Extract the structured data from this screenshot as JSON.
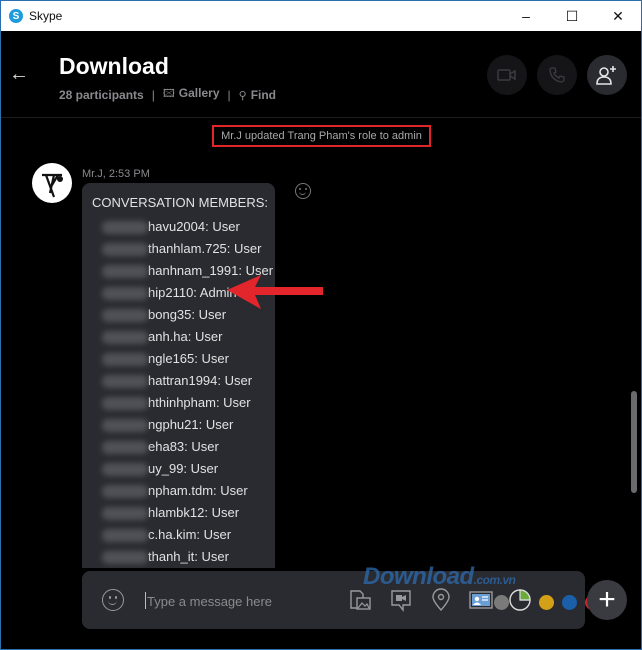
{
  "window": {
    "app_title": "Skype",
    "controls": {
      "minimize": "–",
      "maximize": "☐",
      "close": "✕"
    }
  },
  "header": {
    "back_icon": "←",
    "conversation_title": "Download",
    "participants": "28 participants",
    "separator": "|",
    "gallery_label": "Gallery",
    "find_label": "Find",
    "buttons": [
      "video-call",
      "audio-call",
      "add-participant"
    ]
  },
  "system_message": "Mr.J updated Trang Pham's role to admin",
  "message": {
    "sender_time": "Mr.J, 2:53 PM",
    "heading": "CONVERSATION MEMBERS:",
    "members": [
      "havu2004: User",
      "thanhlam.725: User",
      "hanhnam_1991: User",
      "hip2110: Admin",
      "bong35: User",
      "anh.ha: User",
      "ngle165: User",
      "hattran1994: User",
      "hthinhpham: User",
      "ngphu21: User",
      "eha83: User",
      "uy_99: User",
      "npham.tdm: User",
      "hlambk12: User",
      "c.ha.kim: User",
      "thanh_it: User"
    ]
  },
  "composer": {
    "placeholder": "Type a message here",
    "value": "",
    "tools": [
      "emoji",
      "media",
      "video-message",
      "location",
      "contact-card",
      "poll"
    ]
  },
  "watermark": {
    "main": "Download",
    "suffix": ".com.vn"
  },
  "watermark_dots": [
    "#7a7a7a",
    "#d4a017",
    "#1b5fa8",
    "#c62828"
  ]
}
